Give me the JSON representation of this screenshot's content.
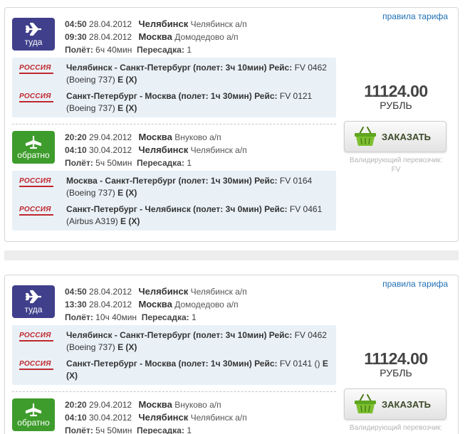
{
  "offers": [
    {
      "rules_link": "правила тарифа",
      "price": "11124.00",
      "currency": "РУБЛЬ",
      "order_label": "ЗАКАЗАТЬ",
      "validator_label": "Валидирующий перевозчик:",
      "validator_code": "FV",
      "outbound": {
        "badge": "туда",
        "dep_time": "04:50",
        "dep_date": "28.04.2012",
        "dep_city": "Челябинск",
        "dep_airport": "Челябинск а/п",
        "arr_time": "09:30",
        "arr_date": "28.04.2012",
        "arr_city": "Москва",
        "arr_airport": "Домодедово а/п",
        "flight_label": "Полёт:",
        "flight_time": "6ч 40мин",
        "transfer_label": "Пересадка:",
        "transfers": "1",
        "segments": [
          {
            "logo": "РОССИЯ",
            "route": "Челябинск - Санкт-Петербург (полет: 3ч 10мин) Рейс:",
            "flight": "FV 0462 (Boeing 737)",
            "class": "E (X)"
          },
          {
            "logo": "РОССИЯ",
            "route": "Санкт-Петербург - Москва (полет: 1ч 30мин) Рейс:",
            "flight": "FV 0121 (Boeing 737)",
            "class": "E (X)"
          }
        ]
      },
      "inbound": {
        "badge": "обратно",
        "dep_time": "20:20",
        "dep_date": "29.04.2012",
        "dep_city": "Москва",
        "dep_airport": "Внуково а/п",
        "arr_time": "04:10",
        "arr_date": "30.04.2012",
        "arr_city": "Челябинск",
        "arr_airport": "Челябинск а/п",
        "flight_label": "Полёт:",
        "flight_time": "5ч 50мин",
        "transfer_label": "Пересадка:",
        "transfers": "1",
        "segments": [
          {
            "logo": "РОССИЯ",
            "route": "Москва - Санкт-Петербург (полет: 1ч 30мин) Рейс:",
            "flight": "FV 0164 (Boeing 737)",
            "class": "E (X)"
          },
          {
            "logo": "РОССИЯ",
            "route": "Санкт-Петербург - Челябинск (полет: 3ч 0мин) Рейс:",
            "flight": "FV 0461 (Airbus A319)",
            "class": "E (X)"
          }
        ]
      }
    },
    {
      "rules_link": "правила тарифа",
      "price": "11124.00",
      "currency": "РУБЛЬ",
      "order_label": "ЗАКАЗАТЬ",
      "validator_label": "Валидирующий перевозчик:",
      "outbound": {
        "badge": "туда",
        "dep_time": "04:50",
        "dep_date": "28.04.2012",
        "dep_city": "Челябинск",
        "dep_airport": "Челябинск а/п",
        "arr_time": "13:30",
        "arr_date": "28.04.2012",
        "arr_city": "Москва",
        "arr_airport": "Домодедово а/п",
        "flight_label": "Полёт:",
        "flight_time": "10ч 40мин",
        "transfer_label": "Пересадка:",
        "transfers": "1",
        "segments": [
          {
            "logo": "РОССИЯ",
            "route": "Челябинск - Санкт-Петербург (полет: 3ч 10мин) Рейс:",
            "flight": "FV 0462 (Boeing 737)",
            "class": "E (X)"
          },
          {
            "logo": "РОССИЯ",
            "route": "Санкт-Петербург - Москва (полет: 1ч 30мин) Рейс:",
            "flight": "FV 0141 ()",
            "class": "E (X)"
          }
        ]
      },
      "inbound": {
        "badge": "обратно",
        "dep_time": "20:20",
        "dep_date": "29.04.2012",
        "dep_city": "Москва",
        "dep_airport": "Внуково а/п",
        "arr_time": "04:10",
        "arr_date": "30.04.2012",
        "arr_city": "Челябинск",
        "arr_airport": "Челябинск а/п",
        "flight_label": "Полёт:",
        "flight_time": "5ч 50мин",
        "transfer_label": "Пересадка:",
        "transfers": "1"
      }
    }
  ],
  "colors": {
    "outbound_badge": "#3f3f8c",
    "inbound_badge": "#3e9c2c",
    "segment_bg": "#e9f1f7",
    "link": "#1f6fb5",
    "airline_logo": "#c0282e"
  },
  "icons": {
    "badge": "airplane-icon",
    "order_button": "basket-icon",
    "airline": "rossiya-logo"
  }
}
